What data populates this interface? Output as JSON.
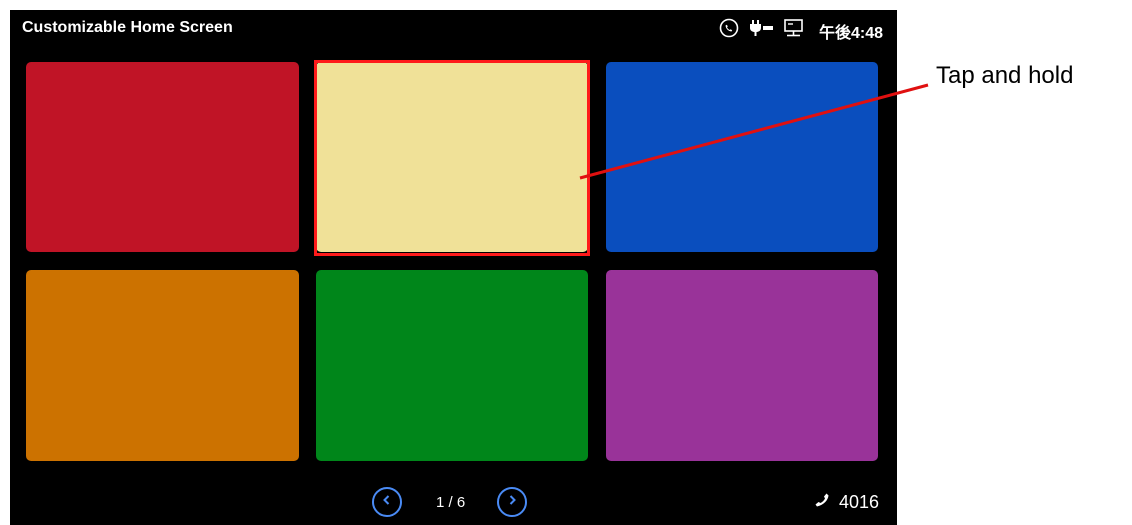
{
  "statusbar": {
    "title": "Customizable Home Screen",
    "time": "午後4:48",
    "icons": [
      "phone-status-icon",
      "poe-plug-icon",
      "network-icon"
    ]
  },
  "tiles": [
    {
      "color": "#c01426"
    },
    {
      "color": "#f0e198"
    },
    {
      "color": "#0a4ebe"
    },
    {
      "color": "#cc7200"
    },
    {
      "color": "#00861a"
    },
    {
      "color": "#993399"
    }
  ],
  "pager": {
    "indicator": "1 / 6",
    "extension": "4016"
  },
  "callout": {
    "label": "Tap and hold",
    "highlight_color": "#ff1a1a"
  },
  "colors": {
    "screen_bg": "#000000",
    "nav_ring": "#4a8bf5"
  }
}
